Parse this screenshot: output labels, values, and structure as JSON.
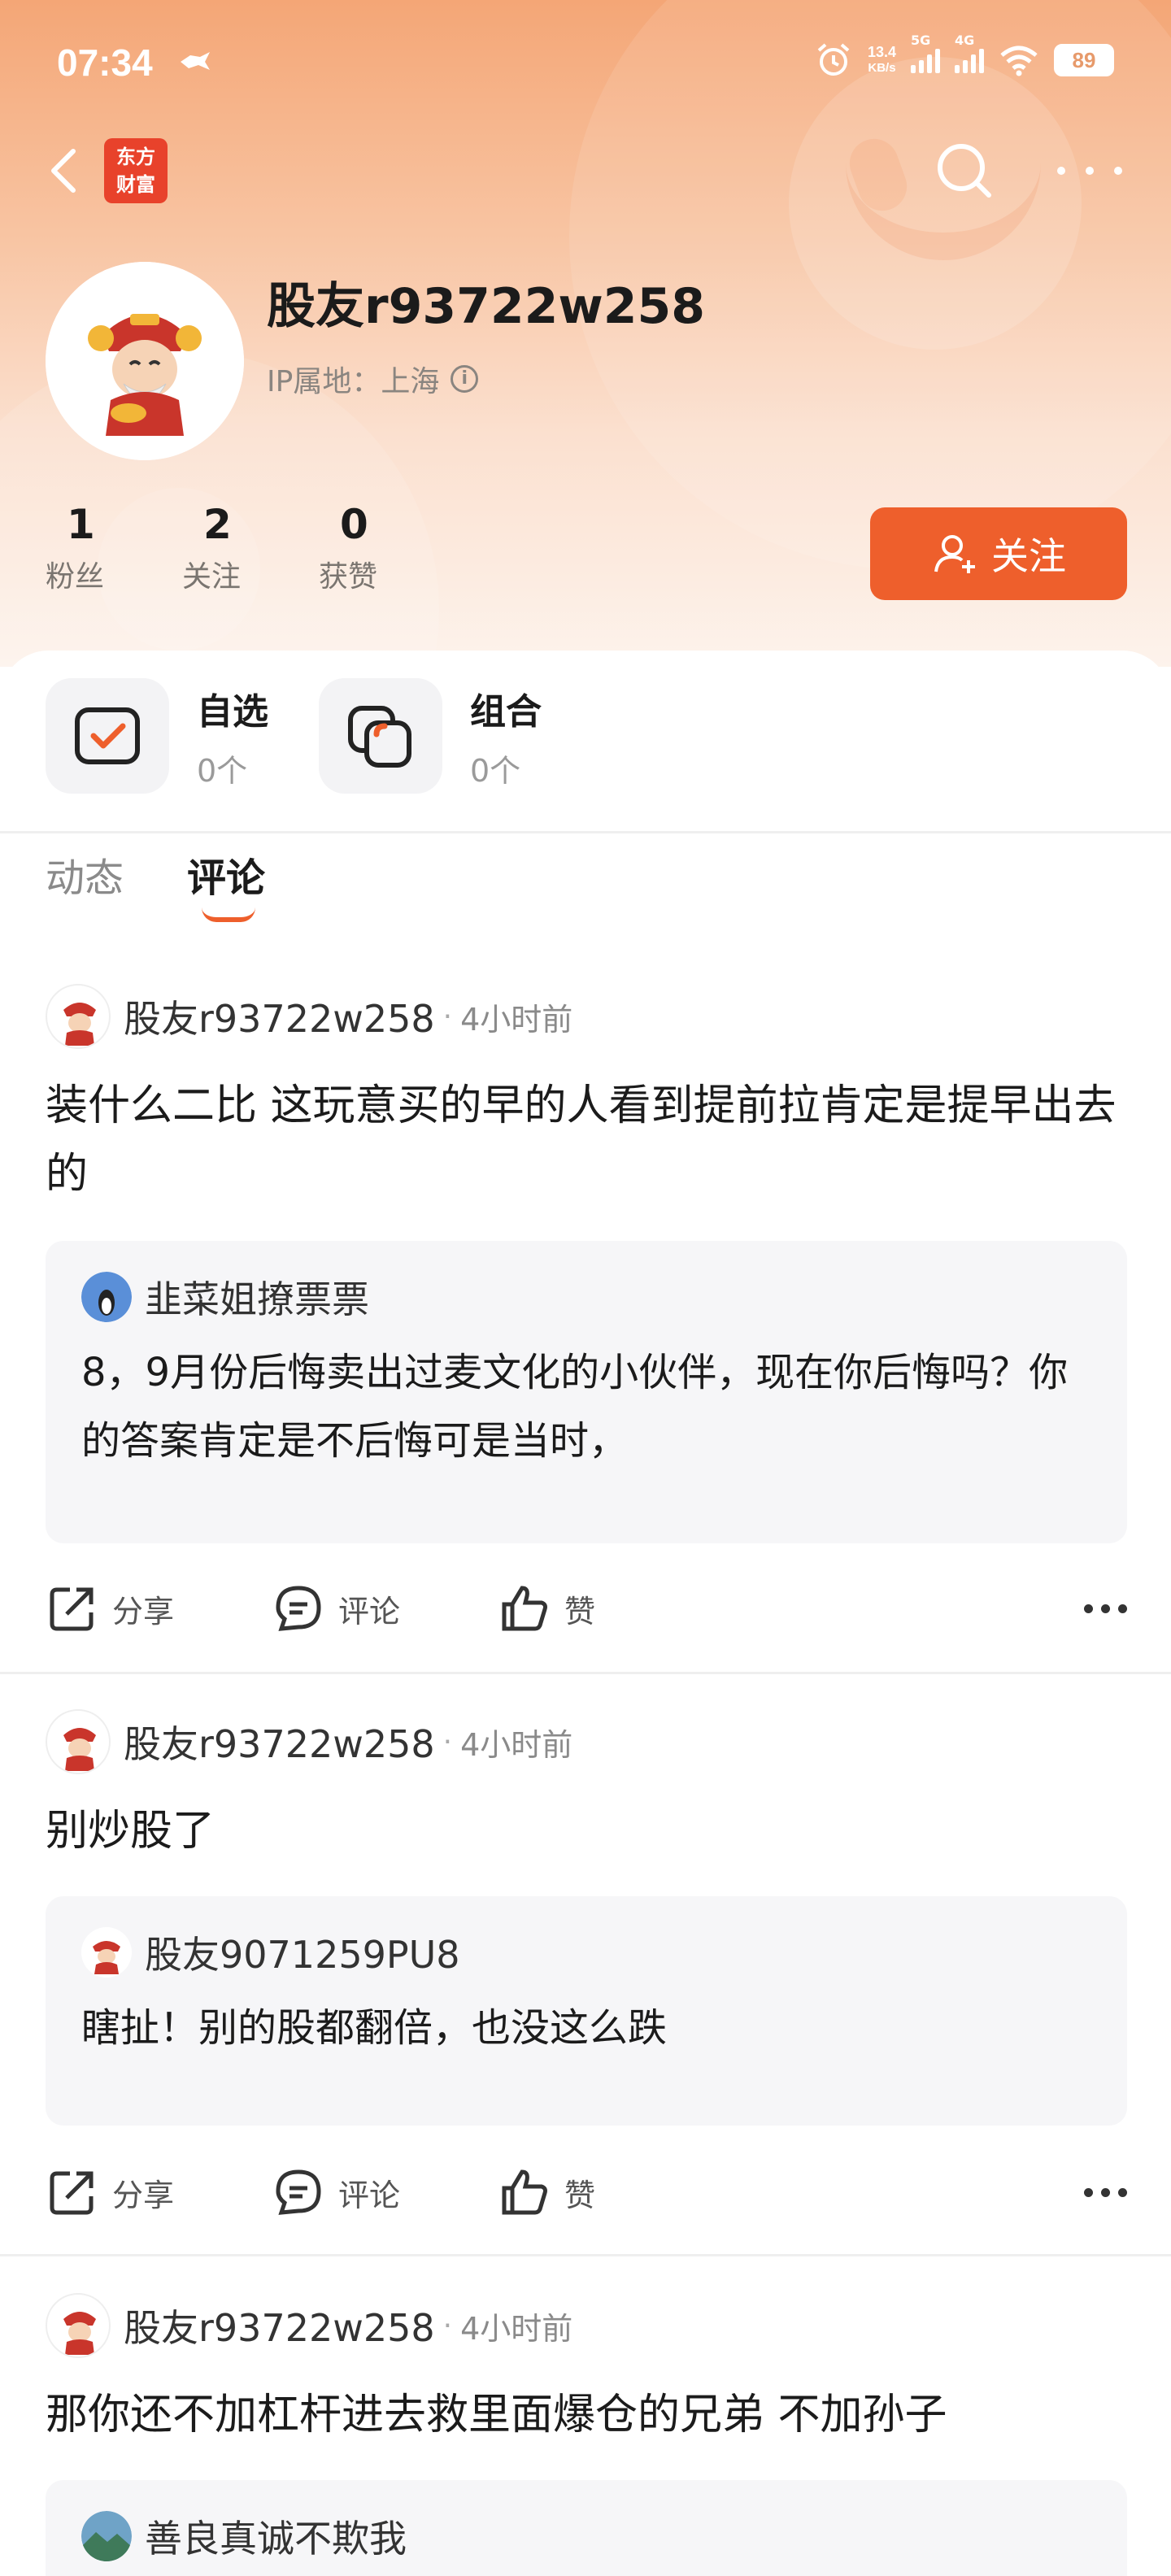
{
  "status_bar": {
    "time": "07:34",
    "speed_value": "13.4",
    "speed_unit": "KB/s",
    "sim1": "5G",
    "sim2": "4G",
    "battery": "89"
  },
  "nav": {
    "logo_line1": "东方",
    "logo_line2": "财富",
    "back_icon": "back-chevron-icon",
    "search_icon": "search-icon",
    "more_icon": "more-dots-icon"
  },
  "profile": {
    "username": "股友r93722w258",
    "ip_location": "IP属地：上海",
    "stats": [
      {
        "value": "1",
        "label": "粉丝"
      },
      {
        "value": "2",
        "label": "关注"
      },
      {
        "value": "0",
        "label": "获赞"
      }
    ],
    "follow_button": "关注"
  },
  "tiles": [
    {
      "title": "自选",
      "count": "0个",
      "icon": "watchlist-icon"
    },
    {
      "title": "组合",
      "count": "0个",
      "icon": "portfolio-icon"
    }
  ],
  "tabs": [
    {
      "label": "动态",
      "active": false
    },
    {
      "label": "评论",
      "active": true
    }
  ],
  "actions": {
    "share": "分享",
    "comment": "评论",
    "like": "赞"
  },
  "posts": [
    {
      "author": "股友r93722w258",
      "time": "4小时前",
      "body": "装什么二比 这玩意买的早的人看到提前拉肯定是提早出去的",
      "quote_author": "韭菜姐撩票票",
      "quote_text": "8，9月份后悔卖出过麦文化的小伙伴，现在你后悔吗？你的答案肯定是不后悔可是当时，"
    },
    {
      "author": "股友r93722w258",
      "time": "4小时前",
      "body": "别炒股了",
      "quote_author": "股友9071259PU8",
      "quote_text": "瞎扯！别的股都翻倍，也没这么跌"
    },
    {
      "author": "股友r93722w258",
      "time": "4小时前",
      "body": "那你还不加杠杆进去救里面爆仓的兄弟 不加孙子",
      "quote_author": "善良真诚不欺我",
      "quote_text": ""
    }
  ],
  "colors": {
    "accent": "#ee5f2c",
    "header_top": "#f4a676",
    "quote_bg": "#f6f6f8"
  }
}
